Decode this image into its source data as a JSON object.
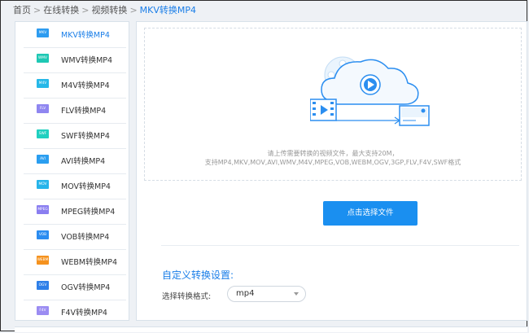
{
  "breadcrumb": {
    "items": [
      "首页",
      "在线转换",
      "视频转换"
    ],
    "separator": ">",
    "current": "MKV转换MP4"
  },
  "sidebar": {
    "items": [
      {
        "icon_text": "MKV",
        "label": "MKV转换MP4",
        "color": "#2d9cf0",
        "active": true
      },
      {
        "icon_text": "WMV",
        "label": "WMV转换MP4",
        "color": "#1ec8b4"
      },
      {
        "icon_text": "M4V",
        "label": "M4V转换MP4",
        "color": "#26b8e8"
      },
      {
        "icon_text": "FLV",
        "label": "FLV转换MP4",
        "color": "#8f86f0"
      },
      {
        "icon_text": "SWF",
        "label": "SWF转换MP4",
        "color": "#20d0c0"
      },
      {
        "icon_text": "AVI",
        "label": "AVI转换MP4",
        "color": "#2a9ef0"
      },
      {
        "icon_text": "MOV",
        "label": "MOV转换MP4",
        "color": "#26b4ea"
      },
      {
        "icon_text": "MPEG",
        "label": "MPEG转换MP4",
        "color": "#8a7ef0"
      },
      {
        "icon_text": "VOB",
        "label": "VOB转换MP4",
        "color": "#2b8cf0"
      },
      {
        "icon_text": "WEBM",
        "label": "WEBM转换MP4",
        "color": "#f5921e"
      },
      {
        "icon_text": "OGV",
        "label": "OGV转换MP4",
        "color": "#2e7fe8"
      },
      {
        "icon_text": "F4V",
        "label": "F4V转换MP4",
        "color": "#9b8cf2"
      }
    ]
  },
  "upload": {
    "hint_line1": "请上传需要转换的视频文件，最大支持20M，",
    "hint_line2": "支持MP4,MKV,MOV,AVI,WMV,M4V,MPEG,VOB,WEBM,OGV,3GP,FLV,F4V,SWF格式",
    "button_label": "点击选择文件",
    "illustration_icon": "cloud-video-upload-icon"
  },
  "settings": {
    "title": "自定义转换设置:",
    "format_label": "选择转换格式:",
    "format_value": "mp4"
  },
  "colors": {
    "accent": "#1a7ee8",
    "button": "#1a8ff0"
  }
}
